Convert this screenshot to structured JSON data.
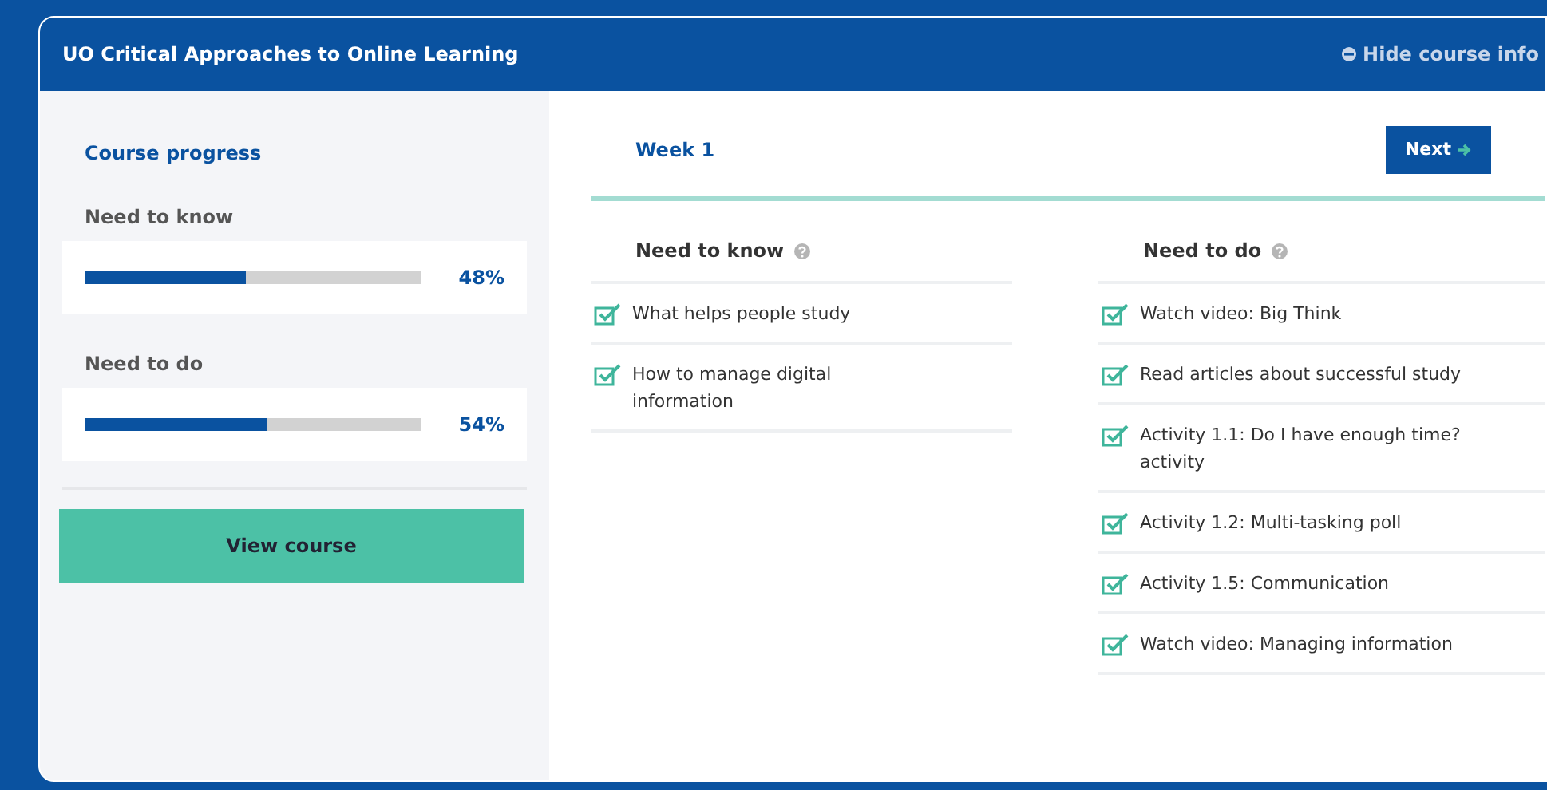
{
  "header": {
    "title": "UO Critical Approaches to Online Learning",
    "toggle": "Hide course info"
  },
  "sidebar": {
    "title": "Course progress",
    "progress": [
      {
        "label": "Need to know",
        "level": 0.48,
        "reading": "48%"
      },
      {
        "label": "Need to do",
        "level": 0.54,
        "reading": "54%"
      }
    ],
    "button": "View course"
  },
  "week": {
    "title": "Week 1",
    "next": "Next"
  },
  "columns": [
    {
      "heading": "Need to know",
      "items": [
        {
          "text": "What helps people study",
          "checked": true
        },
        {
          "text": "How to manage digital information",
          "checked": true
        }
      ]
    },
    {
      "heading": "Need to do",
      "items": [
        {
          "text": "Watch video: Big Think",
          "checked": true
        },
        {
          "text": "Read articles about successful study",
          "checked": true
        },
        {
          "text": "Activity 1.1: Do I have enough time? activity",
          "checked": true
        },
        {
          "text": "Activity 1.2: Multi-tasking poll",
          "checked": true
        },
        {
          "text": "Activity 1.5: Communication",
          "checked": true
        },
        {
          "text": "Watch video: Managing information",
          "checked": true
        }
      ]
    }
  ]
}
